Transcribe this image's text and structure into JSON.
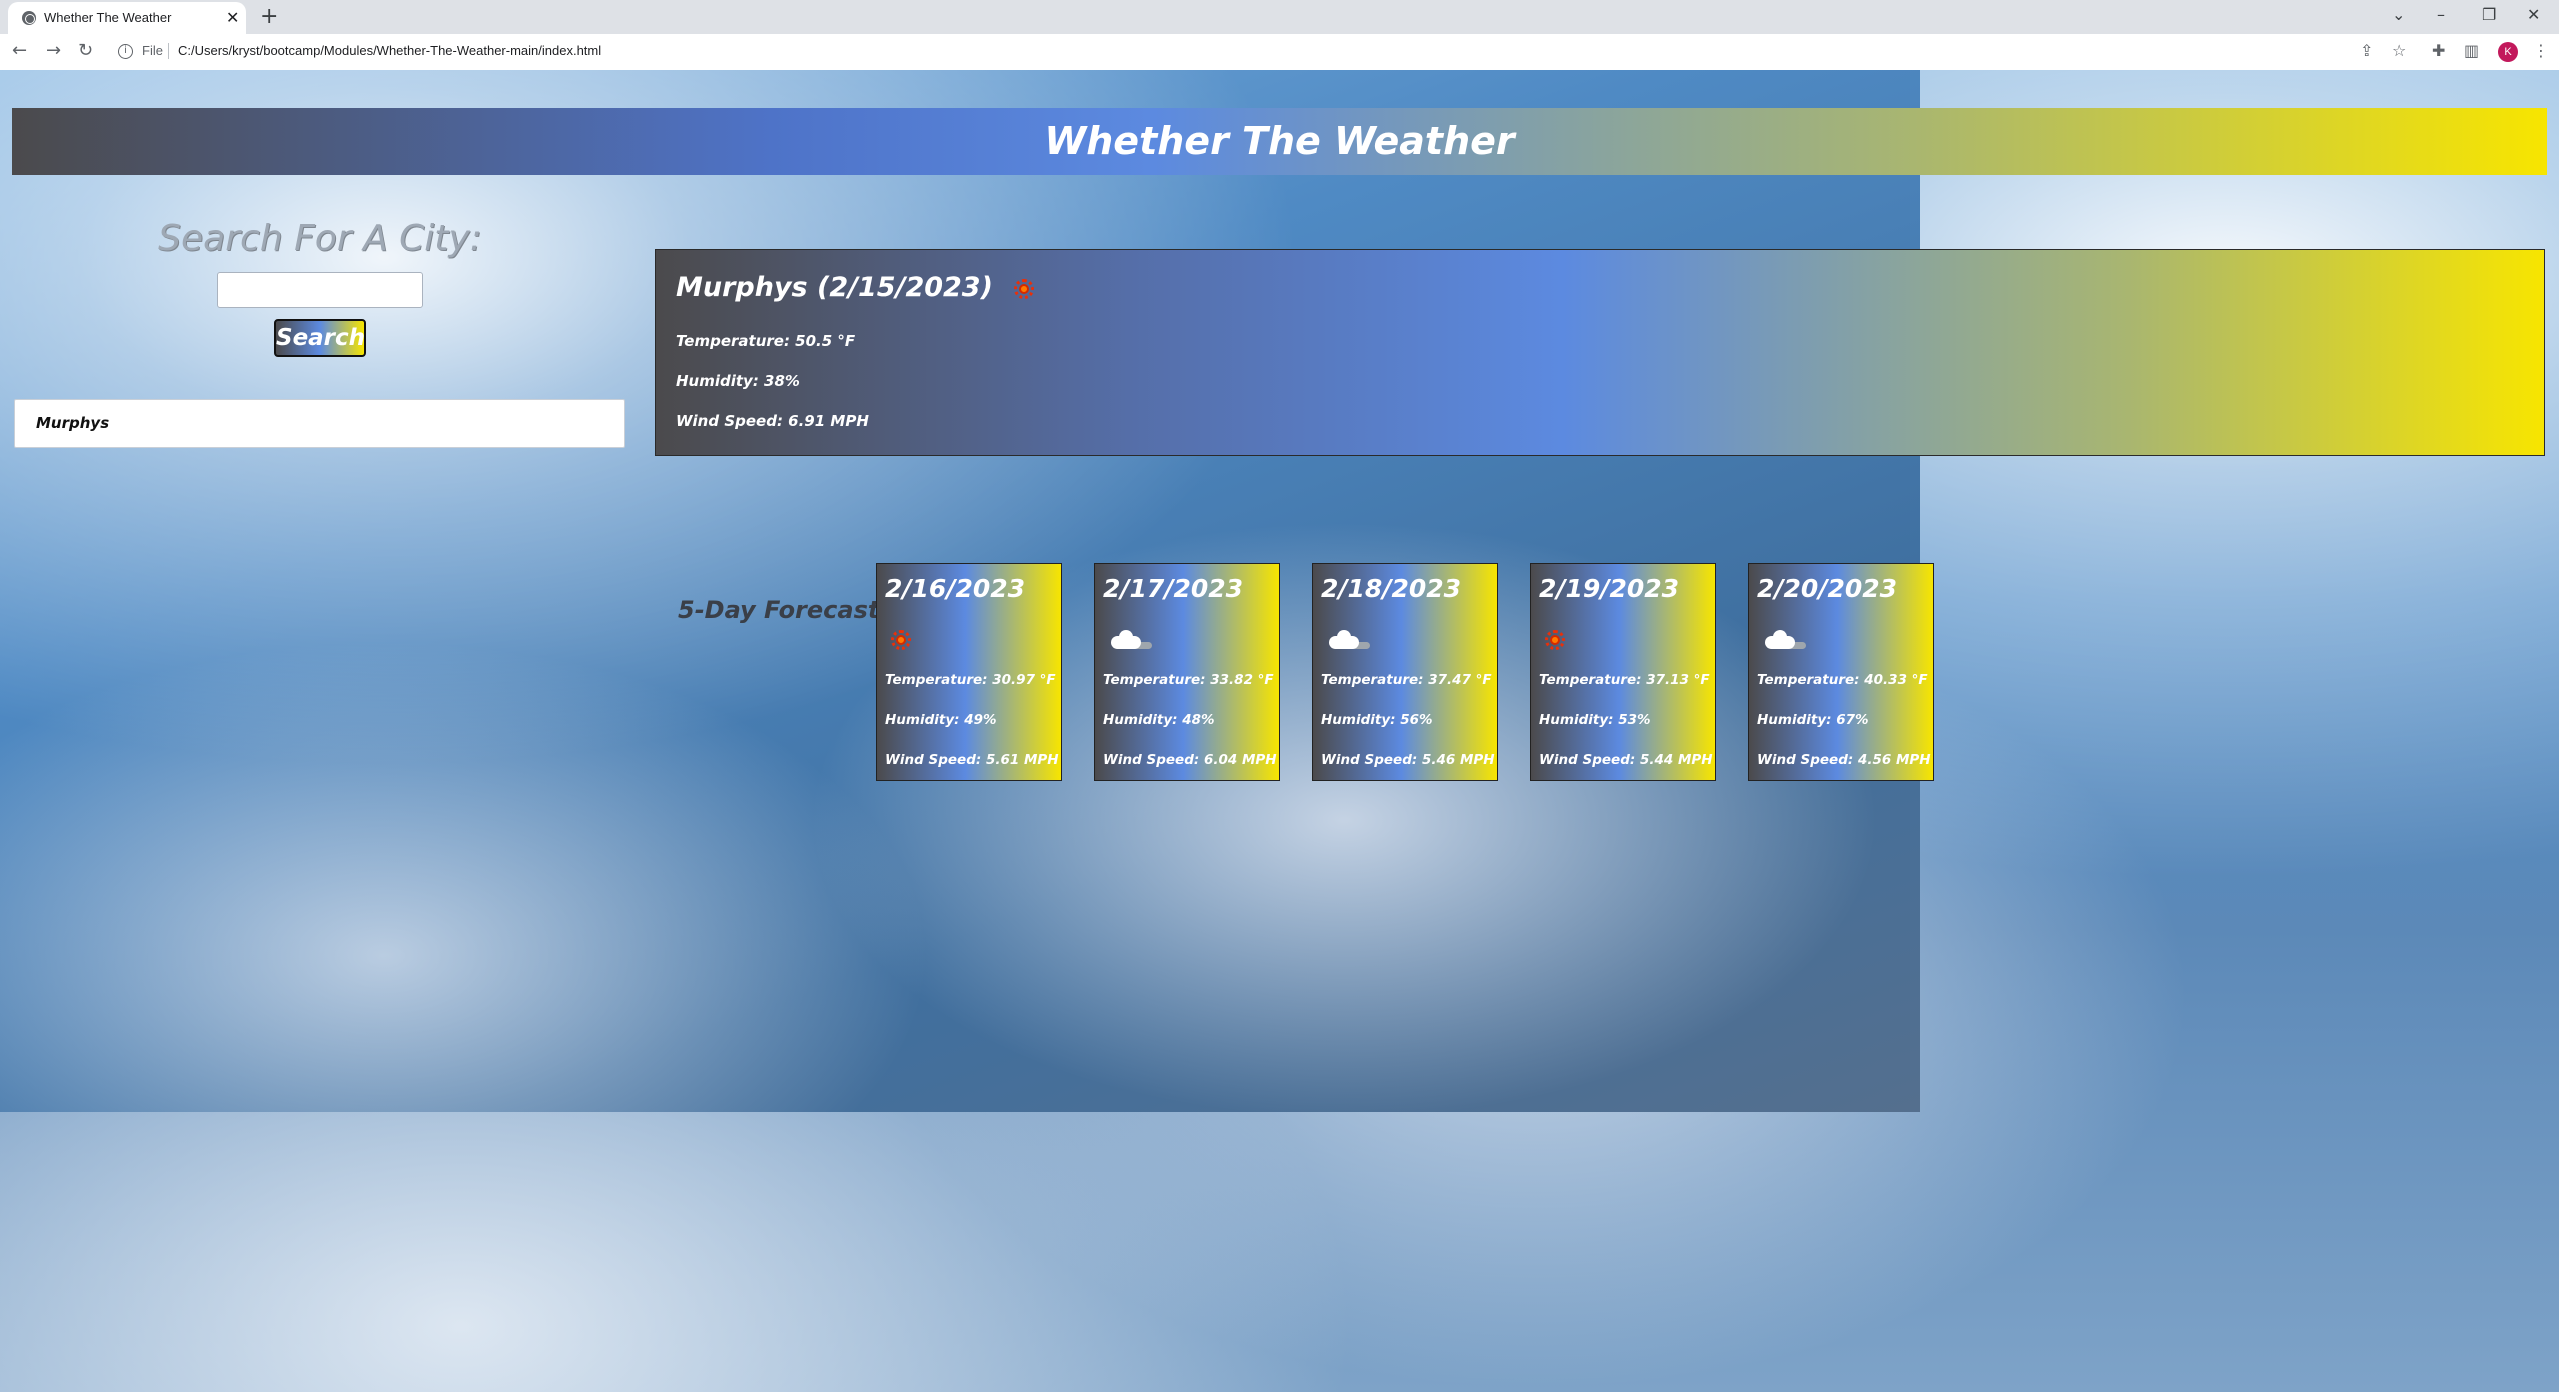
{
  "browser": {
    "tab_title": "Whether The Weather",
    "tab_close": "✕",
    "new_tab": "+",
    "file_label": "File",
    "url": "C:/Users/kryst/bootcamp/Modules/Whether-The-Weather-main/index.html",
    "profile_initial": "K"
  },
  "header": {
    "title": "Whether The Weather"
  },
  "search": {
    "heading": "Search For A City:",
    "input_value": "",
    "button_label": "Search"
  },
  "history": [
    {
      "city": "Murphys"
    }
  ],
  "current": {
    "title": "Murphys (2/15/2023)",
    "icon": "sun-icon",
    "temperature": "Temperature: 50.5 °F",
    "humidity": "Humidity: 38%",
    "wind": "Wind Speed: 6.91 MPH"
  },
  "forecast": {
    "label": "5-Day Forecast:",
    "days": [
      {
        "date": "2/16/2023",
        "icon": "sun-icon",
        "temperature": "Temperature: 30.97 °F",
        "humidity": "Humidity: 49%",
        "wind": "Wind Speed: 5.61 MPH"
      },
      {
        "date": "2/17/2023",
        "icon": "cloud-icon",
        "temperature": "Temperature: 33.82 °F",
        "humidity": "Humidity: 48%",
        "wind": "Wind Speed: 6.04 MPH"
      },
      {
        "date": "2/18/2023",
        "icon": "cloud-icon",
        "temperature": "Temperature: 37.47 °F",
        "humidity": "Humidity: 56%",
        "wind": "Wind Speed: 5.46 MPH"
      },
      {
        "date": "2/19/2023",
        "icon": "sun-icon",
        "temperature": "Temperature: 37.13 °F",
        "humidity": "Humidity: 53%",
        "wind": "Wind Speed: 5.44 MPH"
      },
      {
        "date": "2/20/2023",
        "icon": "cloud-icon",
        "temperature": "Temperature: 40.33 °F",
        "humidity": "Humidity: 67%",
        "wind": "Wind Speed: 4.56 MPH"
      }
    ]
  },
  "colors": {
    "gradient_start": "#4b4a4c",
    "gradient_mid": "#5c8ae0",
    "gradient_end": "#f7e500"
  }
}
